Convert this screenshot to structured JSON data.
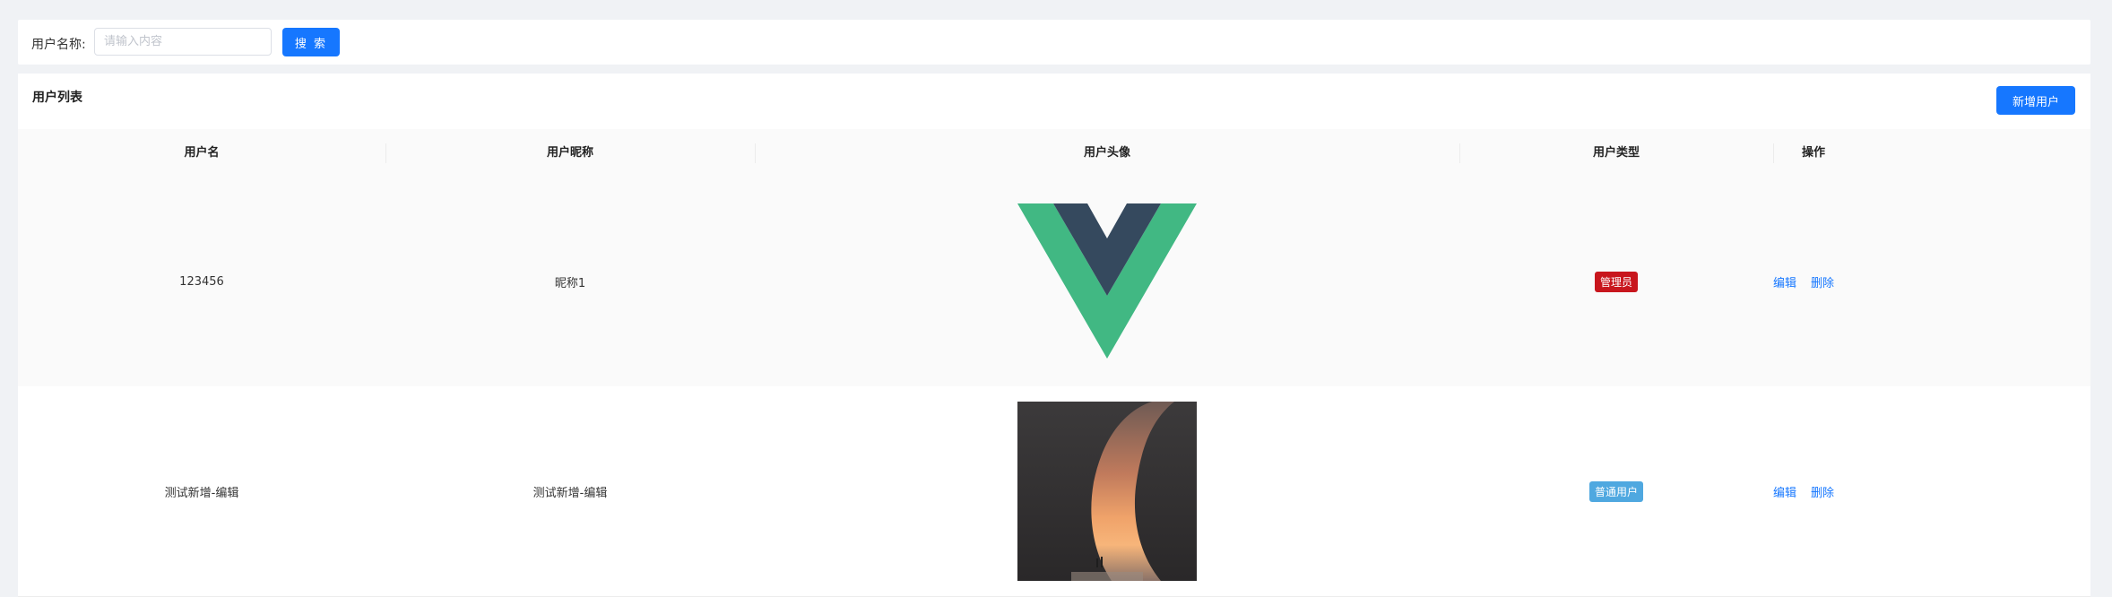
{
  "search": {
    "label": "用户名称:",
    "placeholder": "请输入内容",
    "value": "",
    "button_label": "搜 索"
  },
  "list": {
    "title": "用户列表",
    "add_button_label": "新增用户",
    "columns": [
      "用户名",
      "用户昵称",
      "用户头像",
      "用户类型",
      "操作"
    ],
    "rows": [
      {
        "username": "123456",
        "nickname": "昵称1",
        "avatar": "vue-logo-image",
        "type_label": "管理员",
        "edit_label": "编辑",
        "delete_label": "删除"
      },
      {
        "username": "测试新增-编辑",
        "nickname": "测试新增-编辑",
        "avatar": "crescent-sunset-photo",
        "type_label": "普通用户",
        "edit_label": "编辑",
        "delete_label": "删除"
      }
    ]
  },
  "colors": {
    "primary": "#1677ff",
    "admin_tag": "#c8161d",
    "user_tag": "#4fa8e0",
    "page_bg": "#f0f2f5"
  }
}
